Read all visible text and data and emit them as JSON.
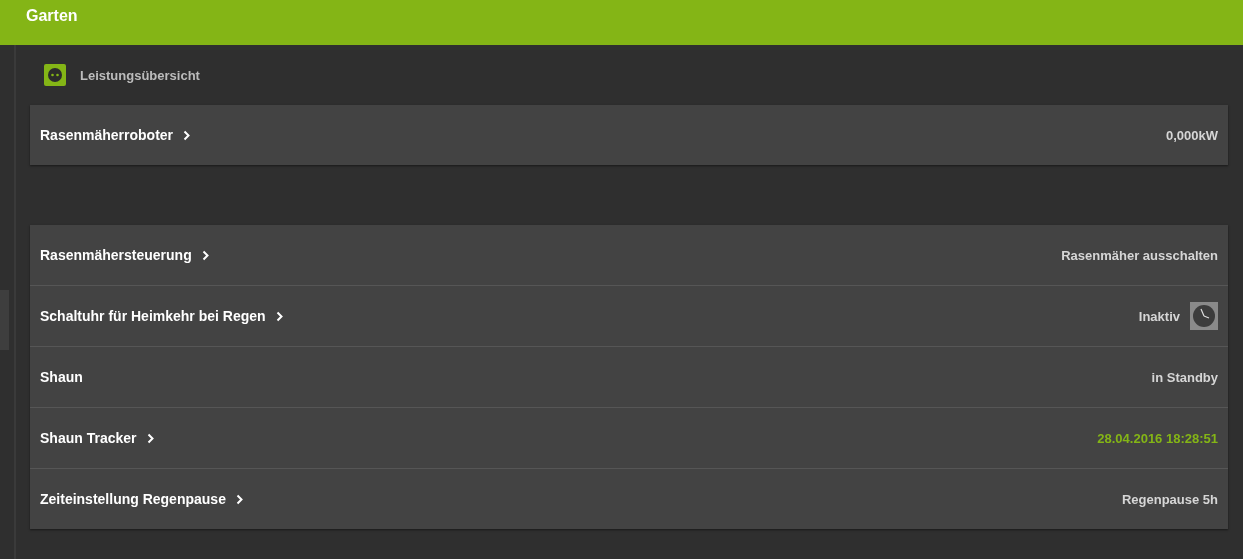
{
  "header": {
    "title": "Garten"
  },
  "section": {
    "label": "Leistungsübersicht"
  },
  "groups": [
    {
      "rows": [
        {
          "label": "Rasenmäherroboter",
          "navigable": true,
          "kind": "text",
          "value": "0,000kW"
        }
      ]
    },
    {
      "rows": [
        {
          "label": "Rasenmähersteuerung",
          "navigable": true,
          "kind": "text",
          "value": "Rasenmäher ausschalten"
        },
        {
          "label": "Schaltuhr für Heimkehr bei Regen",
          "navigable": true,
          "kind": "timer",
          "value": "Inaktiv"
        },
        {
          "label": "Shaun",
          "navigable": false,
          "kind": "text",
          "value": "in Standby"
        },
        {
          "label": "Shaun Tracker",
          "navigable": true,
          "kind": "timestamp",
          "value": "28.04.2016 18:28:51"
        },
        {
          "label": "Zeiteinstellung Regenpause",
          "navigable": true,
          "kind": "text",
          "value": "Regenpause 5h"
        }
      ]
    }
  ]
}
